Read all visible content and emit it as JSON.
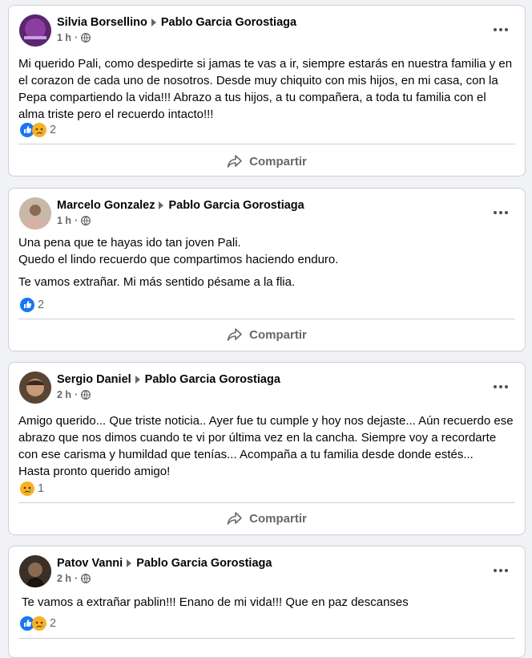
{
  "colors": {
    "background": "#f0f2f5",
    "card": "#ffffff",
    "like_blue": "#1877f2",
    "sad_yellow": "#f7b125",
    "secondary_text": "#65676b"
  },
  "posts": [
    {
      "author": "Silvia Borsellino",
      "target": "Pablo Garcia Gorostiaga",
      "time": "1 h",
      "paragraphs": [
        "Mi querido Pali, como despedirte si jamas te vas a ir, siempre estarás en nuestra familia y en el corazon de cada uno de nosotros. Desde muy chiquito con mis hijos, en mi casa, con la Pepa compartiendo la vida!!! Abrazo a tus hijos, a tu compañera, a toda tu familia con el alma triste pero el recuerdo intacto!!!"
      ],
      "reactions": [
        "like",
        "sad"
      ],
      "reaction_count": "2",
      "share_label": "Compartir"
    },
    {
      "author": "Marcelo Gonzalez",
      "target": "Pablo Garcia Gorostiaga",
      "time": "1 h",
      "paragraphs": [
        "Una pena que te hayas ido tan joven Pali.",
        "Quedo el lindo recuerdo que compartimos haciendo enduro.",
        "Te vamos extrañar. Mi más sentido pésame a la flia."
      ],
      "reactions": [
        "like"
      ],
      "reaction_count": "2",
      "share_label": "Compartir"
    },
    {
      "author": "Sergio Daniel",
      "target": "Pablo Garcia Gorostiaga",
      "time": "2 h",
      "paragraphs": [
        "Amigo querido... Que triste noticia.. Ayer fue tu cumple y hoy nos dejaste... Aún recuerdo ese abrazo que nos dimos cuando te vi por última vez en la cancha. Siempre voy a recordarte con ese carisma y humildad que tenías... Acompaña a tu familia desde donde estés...",
        "Hasta pronto querido amigo!"
      ],
      "reactions": [
        "sad"
      ],
      "reaction_count": "1",
      "share_label": "Compartir"
    },
    {
      "author": "Patov Vanni",
      "target": "Pablo Garcia Gorostiaga",
      "time": "2 h",
      "paragraphs": [
        "Te vamos a extrañar pablin!!! Enano de mi vida!!! Que en paz descanses"
      ],
      "reactions": [
        "like",
        "sad"
      ],
      "reaction_count": "2",
      "share_label": ""
    }
  ]
}
